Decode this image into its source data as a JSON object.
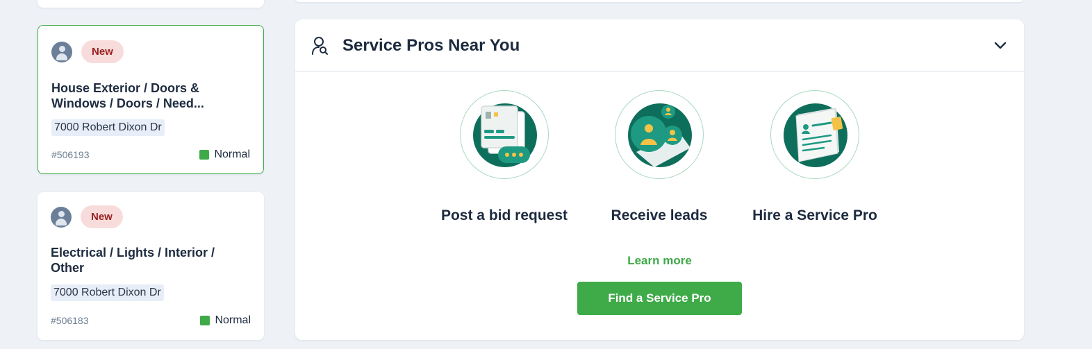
{
  "tickets": [
    {
      "badge": "New",
      "title": "House Exterior / Doors & Windows / Doors / Need...",
      "address": "7000 Robert Dixon Dr",
      "id": "#506193",
      "priority": "Normal"
    },
    {
      "badge": "New",
      "title": "Electrical / Lights / Interior / Other",
      "address": "7000 Robert Dixon Dr",
      "id": "#506183",
      "priority": "Normal"
    }
  ],
  "service_panel": {
    "title": "Service Pros Near You",
    "header_icon": "person-search-icon",
    "collapse_icon": "chevron-down-icon",
    "steps": [
      {
        "label": "Post a bid request",
        "icon": "bid-request-illustration"
      },
      {
        "label": "Receive leads",
        "icon": "receive-leads-illustration"
      },
      {
        "label": "Hire a Service Pro",
        "icon": "hire-pro-illustration"
      }
    ],
    "learn_more": "Learn more",
    "cta": "Find a Service Pro"
  },
  "colors": {
    "accent_green": "#3faa48",
    "illustration_teal": "#0e6e5c",
    "badge_bg": "#f8dcdc",
    "badge_text": "#9a1f1f",
    "background": "#eef2f7"
  }
}
